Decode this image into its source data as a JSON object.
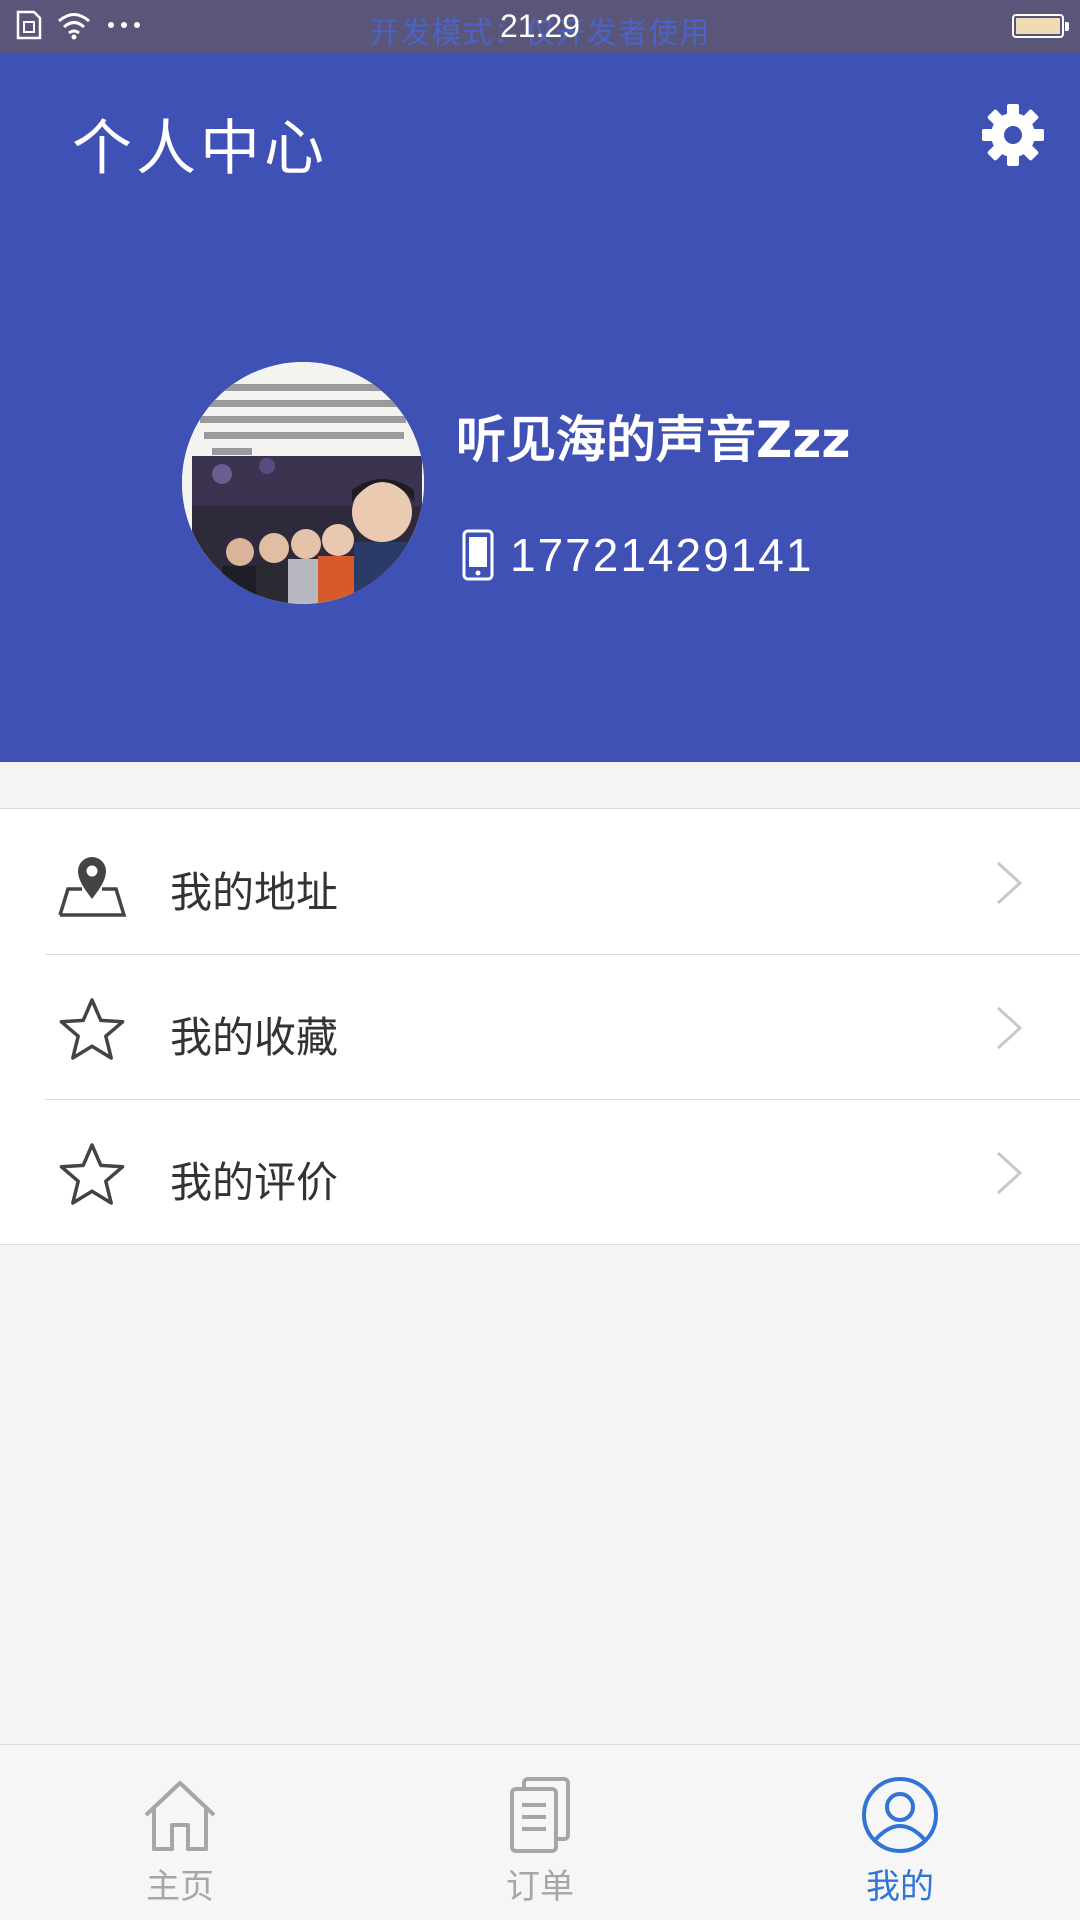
{
  "status_bar": {
    "dev_mode_text": "开发模式：仅开发者使用",
    "time": "21:29",
    "icons": [
      "sim-icon",
      "wifi-icon",
      "more-dots-icon",
      "battery-icon"
    ]
  },
  "header": {
    "title": "个人中心",
    "settings_icon": "gear-icon",
    "background_color": "#4051b5"
  },
  "profile": {
    "username": "听见海的声音Zzz",
    "phone": "17721429141",
    "phone_icon": "phone-icon"
  },
  "menu": {
    "items": [
      {
        "label": "我的地址",
        "icon": "map-pin-icon"
      },
      {
        "label": "我的收藏",
        "icon": "star-icon"
      },
      {
        "label": "我的评价",
        "icon": "star-icon"
      }
    ]
  },
  "tab_bar": {
    "tabs": [
      {
        "label": "主页",
        "icon": "home-icon",
        "active": false
      },
      {
        "label": "订单",
        "icon": "order-list-icon",
        "active": false
      },
      {
        "label": "我的",
        "icon": "user-icon",
        "active": true
      }
    ],
    "active_color": "#2f74d6",
    "inactive_color": "#a6a6a6"
  }
}
